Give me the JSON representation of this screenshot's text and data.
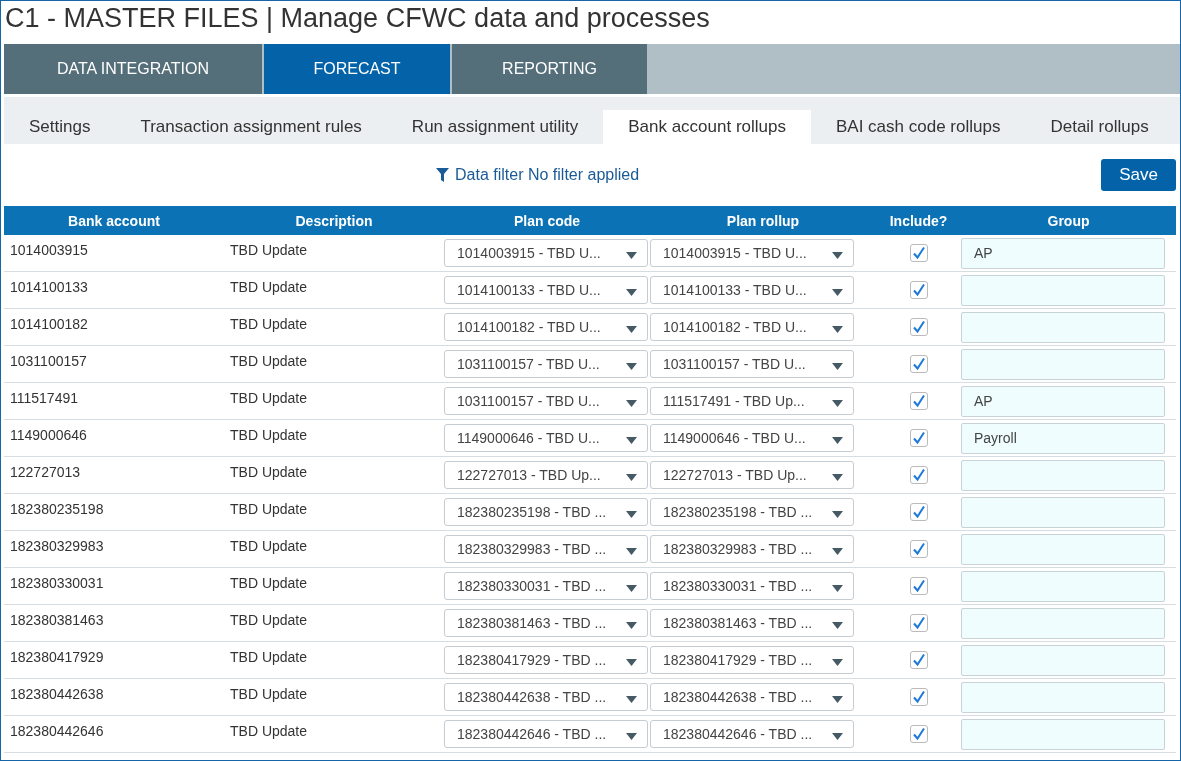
{
  "page_title": "C1 - MASTER FILES | Manage CFWC data and processes",
  "main_tabs": [
    {
      "label": "DATA INTEGRATION",
      "selected": false
    },
    {
      "label": "FORECAST",
      "selected": true
    },
    {
      "label": "REPORTING",
      "selected": false
    }
  ],
  "sub_tabs": [
    {
      "label": "Settings",
      "selected": false
    },
    {
      "label": "Transaction assignment rules",
      "selected": false
    },
    {
      "label": "Run assignment utility",
      "selected": false
    },
    {
      "label": "Bank account rollups",
      "selected": true
    },
    {
      "label": "BAI cash code rollups",
      "selected": false
    },
    {
      "label": "Detail rollups",
      "selected": false
    }
  ],
  "filter": {
    "label": "Data filter",
    "status": "No filter applied"
  },
  "save_button": "Save",
  "table": {
    "columns": [
      "Bank account",
      "Description",
      "Plan code",
      "Plan rollup",
      "Include?",
      "Group"
    ],
    "rows": [
      {
        "bank_account": "1014003915",
        "description": "TBD Update",
        "plan_code": "1014003915 - TBD U...",
        "plan_rollup": "1014003915 - TBD U...",
        "include": true,
        "group": "AP"
      },
      {
        "bank_account": "1014100133",
        "description": "TBD Update",
        "plan_code": "1014100133 - TBD U...",
        "plan_rollup": "1014100133 - TBD U...",
        "include": true
      },
      {
        "bank_account": "1014100182",
        "description": "TBD Update",
        "plan_code": "1014100182 - TBD U...",
        "plan_rollup": "1014100182 - TBD U...",
        "include": true
      },
      {
        "bank_account": "1031100157",
        "description": "TBD Update",
        "plan_code": "1031100157 - TBD U...",
        "plan_rollup": "1031100157 - TBD U...",
        "include": true
      },
      {
        "bank_account": "111517491",
        "description": "TBD Update",
        "plan_code": "1031100157 - TBD U...",
        "plan_rollup": "111517491 - TBD Up...",
        "include": true,
        "group": "AP"
      },
      {
        "bank_account": "1149000646",
        "description": "TBD Update",
        "plan_code": "1149000646 - TBD U...",
        "plan_rollup": "1149000646 - TBD U...",
        "include": true,
        "group": "Payroll"
      },
      {
        "bank_account": "122727013",
        "description": "TBD Update",
        "plan_code": "122727013 - TBD Up...",
        "plan_rollup": "122727013 - TBD Up...",
        "include": true
      },
      {
        "bank_account": "182380235198",
        "description": "TBD Update",
        "plan_code": "182380235198 - TBD ...",
        "plan_rollup": "182380235198 - TBD ...",
        "include": true
      },
      {
        "bank_account": "182380329983",
        "description": "TBD Update",
        "plan_code": "182380329983 - TBD ...",
        "plan_rollup": "182380329983 - TBD ...",
        "include": true
      },
      {
        "bank_account": "182380330031",
        "description": "TBD Update",
        "plan_code": "182380330031 - TBD ...",
        "plan_rollup": "182380330031 - TBD ...",
        "include": true
      },
      {
        "bank_account": "182380381463",
        "description": "TBD Update",
        "plan_code": "182380381463 - TBD ...",
        "plan_rollup": "182380381463 - TBD ...",
        "include": true
      },
      {
        "bank_account": "182380417929",
        "description": "TBD Update",
        "plan_code": "182380417929 - TBD ...",
        "plan_rollup": "182380417929 - TBD ...",
        "include": true
      },
      {
        "bank_account": "182380442638",
        "description": "TBD Update",
        "plan_code": "182380442638 - TBD ...",
        "plan_rollup": "182380442638 - TBD ...",
        "include": true
      },
      {
        "bank_account": "182380442646",
        "description": "TBD Update",
        "plan_code": "182380442646 - TBD ...",
        "plan_rollup": "182380442646 - TBD ...",
        "include": true
      }
    ]
  }
}
